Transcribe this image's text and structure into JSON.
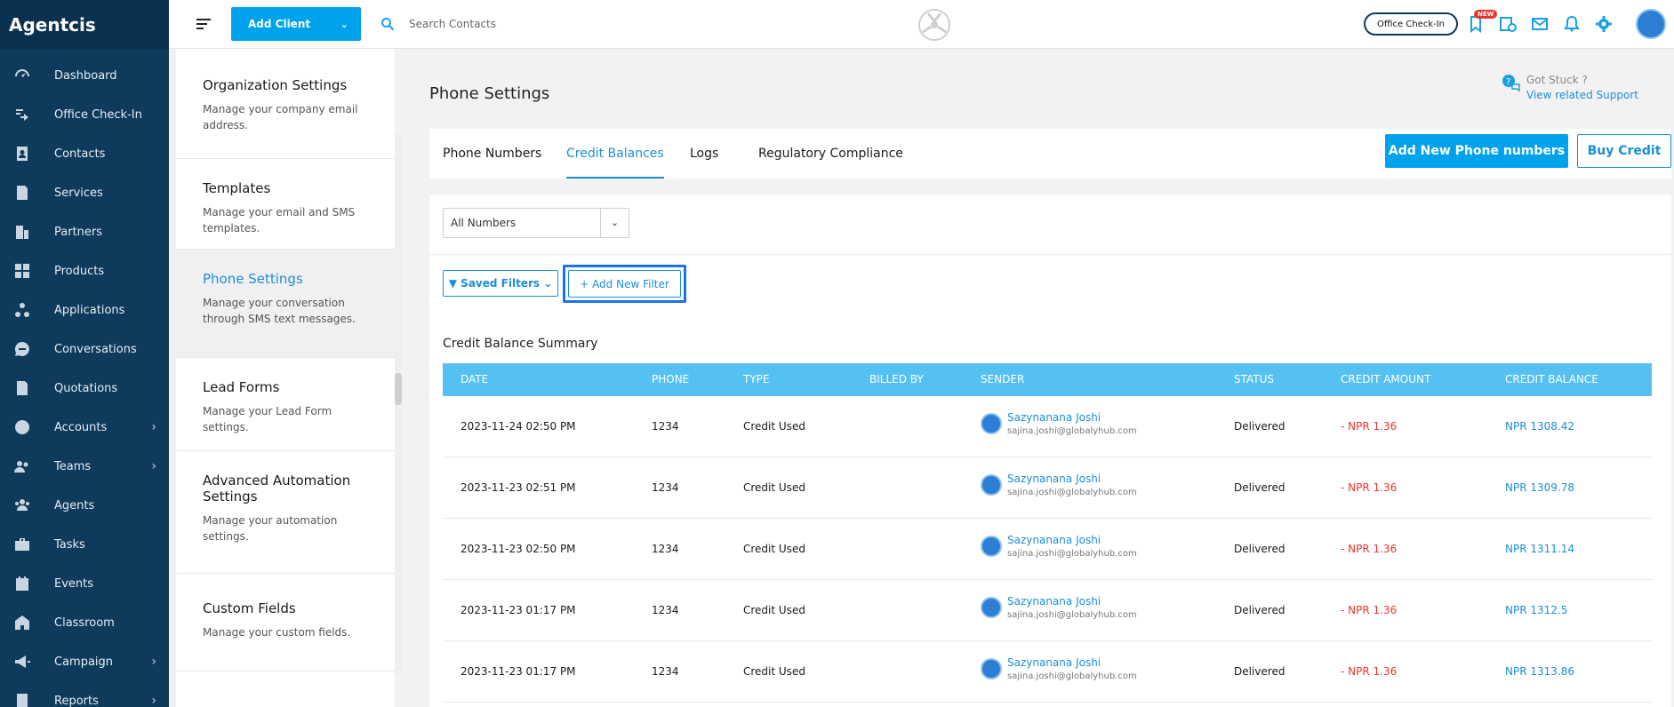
{
  "app": {
    "brand": "Agentcis"
  },
  "sidebar": {
    "items": [
      {
        "label": "Dashboard",
        "icon": "gauge-icon",
        "has_children": false
      },
      {
        "label": "Office Check-In",
        "icon": "checkin-icon",
        "has_children": false
      },
      {
        "label": "Contacts",
        "icon": "contacts-icon",
        "has_children": false
      },
      {
        "label": "Services",
        "icon": "services-icon",
        "has_children": false
      },
      {
        "label": "Partners",
        "icon": "building-icon",
        "has_children": false
      },
      {
        "label": "Products",
        "icon": "products-icon",
        "has_children": false
      },
      {
        "label": "Applications",
        "icon": "applications-icon",
        "has_children": false
      },
      {
        "label": "Conversations",
        "icon": "chat-icon",
        "has_children": false
      },
      {
        "label": "Quotations",
        "icon": "document-icon",
        "has_children": false
      },
      {
        "label": "Accounts",
        "icon": "dollar-icon",
        "has_children": true
      },
      {
        "label": "Teams",
        "icon": "team-icon",
        "has_children": true
      },
      {
        "label": "Agents",
        "icon": "agents-icon",
        "has_children": false
      },
      {
        "label": "Tasks",
        "icon": "briefcase-icon",
        "has_children": false
      },
      {
        "label": "Events",
        "icon": "calendar-icon",
        "has_children": false
      },
      {
        "label": "Classroom",
        "icon": "classroom-icon",
        "has_children": false
      },
      {
        "label": "Campaign",
        "icon": "megaphone-icon",
        "has_children": true
      },
      {
        "label": "Reports",
        "icon": "report-icon",
        "has_children": true
      }
    ]
  },
  "topbar": {
    "add_client_label": "Add Client",
    "search_placeholder": "Search Contacts",
    "office_checkin_label": "Office Check-In",
    "new_badge": "NEW"
  },
  "settings_menu": {
    "items": [
      {
        "title": "Organization Settings",
        "desc": "Manage your company email address.",
        "active": false
      },
      {
        "title": "Templates",
        "desc": "Manage your email and SMS templates.",
        "active": false
      },
      {
        "title": "Phone Settings",
        "desc": "Manage your conversation through SMS text messages.",
        "active": true
      },
      {
        "title": "Lead Forms",
        "desc": "Manage your Lead Form settings.",
        "active": false
      },
      {
        "title": "Advanced Automation Settings",
        "desc": "Manage your automation settings.",
        "active": false
      },
      {
        "title": "Custom Fields",
        "desc": "Manage your custom fields.",
        "active": false
      }
    ]
  },
  "main": {
    "page_title": "Phone Settings",
    "help": {
      "stuck": "Got Stuck ?",
      "support": "View related Support"
    },
    "tabs": [
      {
        "label": "Phone Numbers",
        "active": false
      },
      {
        "label": "Credit Balances",
        "active": true
      },
      {
        "label": "Logs",
        "active": false
      },
      {
        "label": "Regulatory Compliance",
        "active": false
      }
    ],
    "add_numbers_label": "Add New Phone numbers",
    "buy_credit_label": "Buy Credit",
    "numbers_select": "All Numbers",
    "saved_filters_label": "Saved Filters",
    "add_filter_label": "Add New Filter",
    "summary_title": "Credit Balance Summary"
  },
  "table": {
    "columns": [
      "DATE",
      "PHONE",
      "TYPE",
      "BILLED BY",
      "SENDER",
      "STATUS",
      "CREDIT AMOUNT",
      "CREDIT BALANCE"
    ],
    "rows": [
      {
        "date": "2023-11-24 02:50 PM",
        "phone": "1234",
        "type": "Credit Used",
        "billed_by": "",
        "sender_name": "Sazynanana Joshi",
        "sender_email": "sajina.joshi@globalyhub.com",
        "status": "Delivered",
        "amount": "- NPR 1.36",
        "balance": "NPR 1308.42"
      },
      {
        "date": "2023-11-23 02:51 PM",
        "phone": "1234",
        "type": "Credit Used",
        "billed_by": "",
        "sender_name": "Sazynanana Joshi",
        "sender_email": "sajina.joshi@globalyhub.com",
        "status": "Delivered",
        "amount": "- NPR 1.36",
        "balance": "NPR 1309.78"
      },
      {
        "date": "2023-11-23 02:50 PM",
        "phone": "1234",
        "type": "Credit Used",
        "billed_by": "",
        "sender_name": "Sazynanana Joshi",
        "sender_email": "sajina.joshi@globalyhub.com",
        "status": "Delivered",
        "amount": "- NPR 1.36",
        "balance": "NPR 1311.14"
      },
      {
        "date": "2023-11-23 01:17 PM",
        "phone": "1234",
        "type": "Credit Used",
        "billed_by": "",
        "sender_name": "Sazynanana Joshi",
        "sender_email": "sajina.joshi@globalyhub.com",
        "status": "Delivered",
        "amount": "- NPR 1.36",
        "balance": "NPR 1312.5"
      },
      {
        "date": "2023-11-23 01:17 PM",
        "phone": "1234",
        "type": "Credit Used",
        "billed_by": "",
        "sender_name": "Sazynanana Joshi",
        "sender_email": "sajina.joshi@globalyhub.com",
        "status": "Delivered",
        "amount": "- NPR 1.36",
        "balance": "NPR 1313.86"
      }
    ]
  },
  "colors": {
    "sidebar": "#0e3a5c",
    "accent": "#00a2ec",
    "table_header": "#55c1f2",
    "negative": "#e8352f",
    "link": "#1a8fd8"
  }
}
